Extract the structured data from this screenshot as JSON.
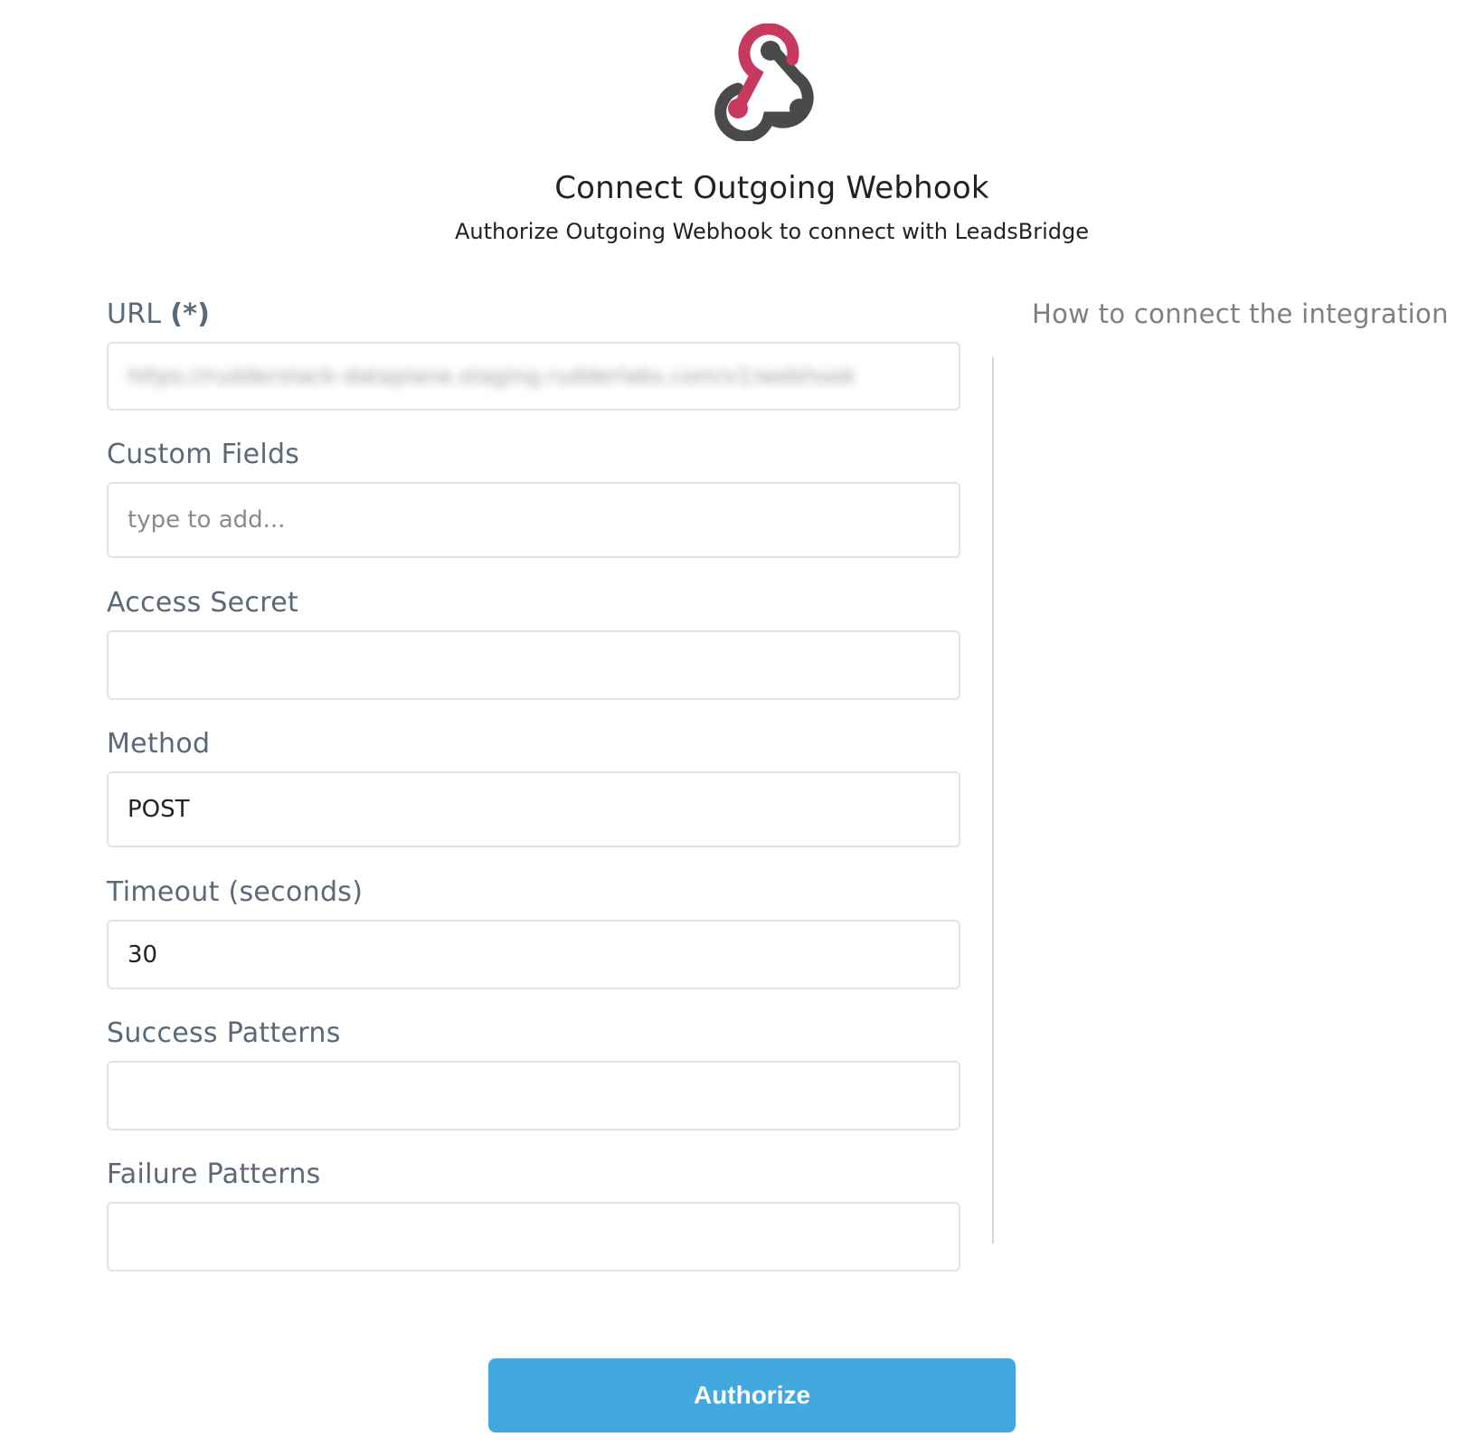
{
  "header": {
    "logo_icon": "webhook-icon",
    "title": "Connect Outgoing Webhook",
    "subtitle": "Authorize Outgoing Webhook to connect with LeadsBridge"
  },
  "form": {
    "url": {
      "label": "URL",
      "required_marker": "(*)",
      "value": "https://rudderstack-dataplane.staging.rudderlabs.com/v1/webhook"
    },
    "custom_fields": {
      "label": "Custom Fields",
      "placeholder": "type to add..."
    },
    "access_secret": {
      "label": "Access Secret",
      "value": ""
    },
    "method": {
      "label": "Method",
      "value": "POST"
    },
    "timeout": {
      "label": "Timeout (seconds)",
      "value": "30"
    },
    "success_patterns": {
      "label": "Success Patterns",
      "value": ""
    },
    "failure_patterns": {
      "label": "Failure Patterns",
      "value": ""
    }
  },
  "sidebar": {
    "help_link": "How to connect the integration"
  },
  "actions": {
    "authorize_label": "Authorize"
  },
  "colors": {
    "logo_pink": "#c7395f",
    "logo_dark": "#4a4a4a",
    "button_blue": "#42a8de",
    "label_gray": "#5a6877"
  }
}
